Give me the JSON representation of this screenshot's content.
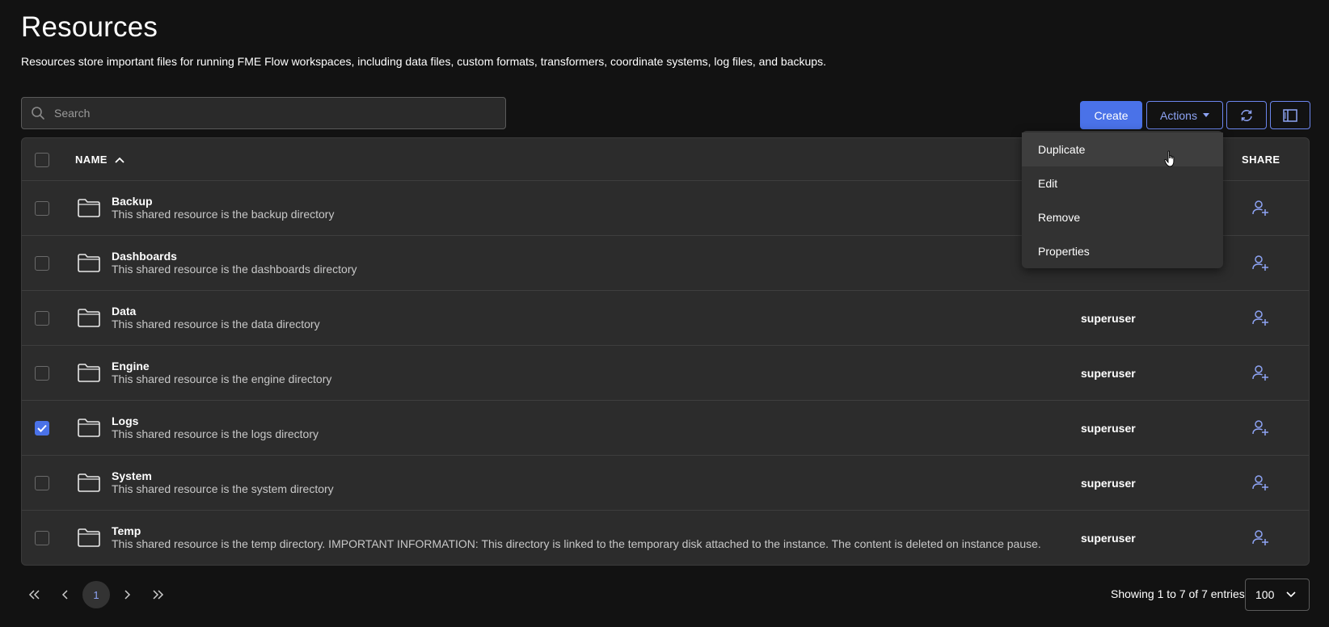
{
  "page": {
    "title": "Resources",
    "description": "Resources store important files for running FME Flow workspaces, including data files, custom formats, transformers, coordinate systems, log files, and backups."
  },
  "search": {
    "placeholder": "Search",
    "value": ""
  },
  "toolbar": {
    "create_label": "Create",
    "actions_label": "Actions",
    "refresh_icon": "refresh-icon",
    "columns_icon": "columns-icon"
  },
  "actions_menu": [
    {
      "label": "Duplicate"
    },
    {
      "label": "Edit"
    },
    {
      "label": "Remove"
    },
    {
      "label": "Properties"
    }
  ],
  "table": {
    "columns": {
      "name": "NAME",
      "share": "SHARE"
    },
    "sort": {
      "column": "NAME",
      "direction": "ascending"
    },
    "rows": [
      {
        "name": "Backup",
        "description": "This shared resource is the backup directory",
        "owner": "",
        "checked": false
      },
      {
        "name": "Dashboards",
        "description": "This shared resource is the dashboards directory",
        "owner": "",
        "checked": false
      },
      {
        "name": "Data",
        "description": "This shared resource is the data directory",
        "owner": "superuser",
        "checked": false
      },
      {
        "name": "Engine",
        "description": "This shared resource is the engine directory",
        "owner": "superuser",
        "checked": false
      },
      {
        "name": "Logs",
        "description": "This shared resource is the logs directory",
        "owner": "superuser",
        "checked": true
      },
      {
        "name": "System",
        "description": "This shared resource is the system directory",
        "owner": "superuser",
        "checked": false
      },
      {
        "name": "Temp",
        "description": "This shared resource is the temp directory. IMPORTANT INFORMATION: This directory is linked to the temporary disk attached to the instance. The content is deleted on instance pause.",
        "owner": "superuser",
        "checked": false
      }
    ]
  },
  "pagination": {
    "current_page": "1",
    "showing_text": "Showing 1 to 7 of 7 entries",
    "page_size": "100"
  },
  "colors": {
    "accent": "#4a72e8",
    "background": "#121212",
    "table_background": "#2c2c2c"
  }
}
